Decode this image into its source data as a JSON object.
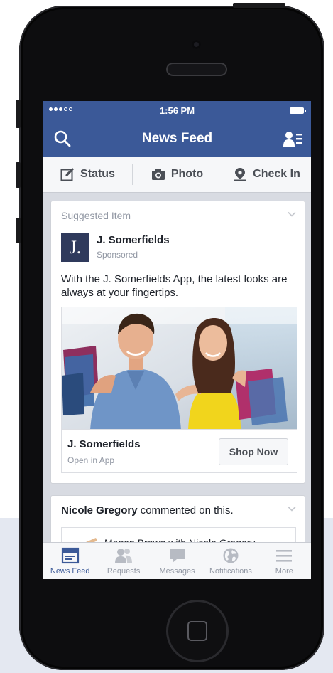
{
  "status_bar": {
    "time": "1:56 PM",
    "signal": "●●●○○"
  },
  "nav": {
    "title": "News Feed"
  },
  "actions": [
    {
      "label": "Status",
      "icon": "compose-icon"
    },
    {
      "label": "Photo",
      "icon": "camera-icon"
    },
    {
      "label": "Check In",
      "icon": "location-pin-icon"
    }
  ],
  "suggested_card": {
    "header": "Suggested Item",
    "logo_letter": "J.",
    "advertiser": "J. Somerfields",
    "sponsored": "Sponsored",
    "text": "With the J. Somerfields App, the latest looks are always at your fingertips.",
    "link_title": "J. Somerfields",
    "link_subtitle": "Open in App",
    "cta": "Shop Now"
  },
  "activity_card": {
    "actor": "Nicole Gregory",
    "action": "commented on this.",
    "preview_text": "Megan Brown with Nicole Gregory"
  },
  "tabs": [
    {
      "label": "News Feed",
      "icon": "news-feed-icon",
      "active": true
    },
    {
      "label": "Requests",
      "icon": "friend-requests-icon",
      "active": false
    },
    {
      "label": "Messages",
      "icon": "messages-icon",
      "active": false
    },
    {
      "label": "Notifications",
      "icon": "globe-icon",
      "active": false
    },
    {
      "label": "More",
      "icon": "menu-icon",
      "active": false
    }
  ],
  "colors": {
    "brand_blue": "#3b5998",
    "feed_background": "#d8dbe2",
    "inactive_gray": "#9197a3"
  }
}
